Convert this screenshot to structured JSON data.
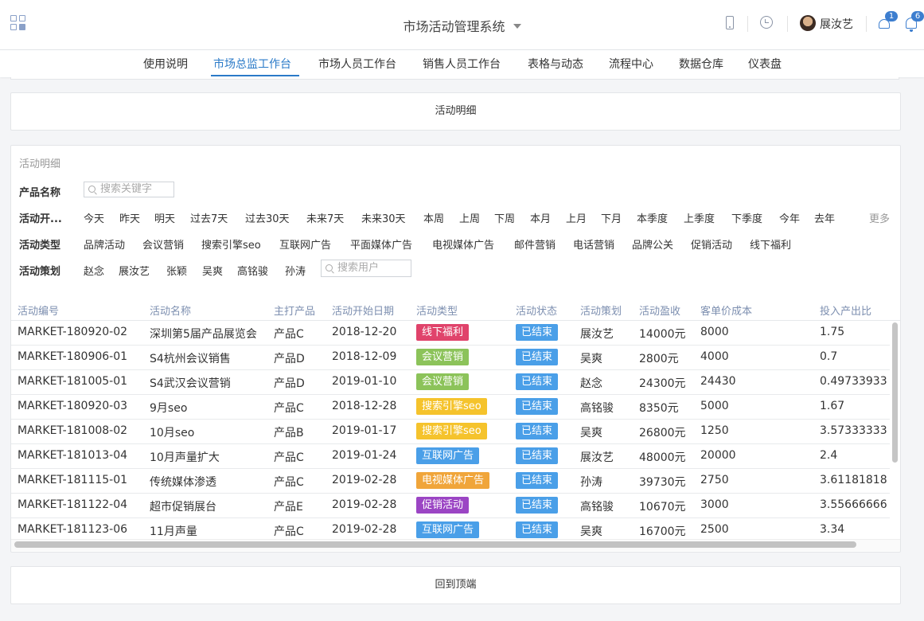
{
  "header": {
    "app_title": "市场活动管理系统",
    "username": "展汝艺",
    "share_badge": "1",
    "bell_badge": "6"
  },
  "nav": {
    "items": [
      "使用说明",
      "市场总监工作台",
      "市场人员工作台",
      "销售人员工作台",
      "表格与动态",
      "流程中心",
      "数据仓库",
      "仪表盘"
    ],
    "active": "市场总监工作台"
  },
  "top_button": "活动明细",
  "bottom_button": "回到顶端",
  "panel": {
    "title": "活动明细",
    "filters": {
      "product": {
        "label": "产品名称",
        "placeholder": "搜索关键字"
      },
      "date": {
        "label": "活动开...",
        "options": [
          "今天",
          "昨天",
          "明天",
          "过去7天",
          "过去30天",
          "未来7天",
          "未来30天",
          "本周",
          "上周",
          "下周",
          "本月",
          "上月",
          "下月",
          "本季度",
          "上季度",
          "下季度",
          "今年",
          "去年"
        ],
        "more": "更多"
      },
      "type": {
        "label": "活动类型",
        "options": [
          "品牌活动",
          "会议营销",
          "搜索引擎seo",
          "互联网广告",
          "平面媒体广告",
          "电视媒体广告",
          "邮件营销",
          "电话营销",
          "品牌公关",
          "促销活动",
          "线下福利"
        ]
      },
      "planner": {
        "label": "活动策划",
        "options": [
          "赵念",
          "展汝艺",
          "张颖",
          "吴爽",
          "高铭骏",
          "孙涛"
        ],
        "placeholder": "搜索用户"
      }
    },
    "columns": [
      "活动编号",
      "活动名称",
      "主打产品",
      "活动开始日期",
      "活动类型",
      "活动状态",
      "活动策划",
      "活动盈收",
      "客单价成本",
      "投入产出比"
    ],
    "rows": [
      {
        "id": "MARKET-180920-02",
        "name": "深圳第5届产品展览会",
        "product": "产品C",
        "date": "2018-12-20",
        "type": "线下福利",
        "type_color": "#e0436b",
        "status": "已结束",
        "planner": "展汝艺",
        "revenue": "14000元",
        "cost": "8000",
        "roi": "1.75"
      },
      {
        "id": "MARKET-180906-01",
        "name": "S4杭州会议销售",
        "product": "产品D",
        "date": "2018-12-09",
        "type": "会议营销",
        "type_color": "#8cc35a",
        "status": "已结束",
        "planner": "吴爽",
        "revenue": "2800元",
        "cost": "4000",
        "roi": "0.7"
      },
      {
        "id": "MARKET-181005-01",
        "name": "S4武汉会议营销",
        "product": "产品D",
        "date": "2019-01-10",
        "type": "会议营销",
        "type_color": "#8cc35a",
        "status": "已结束",
        "planner": "赵念",
        "revenue": "24300元",
        "cost": "24430",
        "roi": "0.49733933"
      },
      {
        "id": "MARKET-180920-03",
        "name": "9月seo",
        "product": "产品C",
        "date": "2018-12-28",
        "type": "搜索引擎seo",
        "type_color": "#f5c32c",
        "status": "已结束",
        "planner": "高铭骏",
        "revenue": "8350元",
        "cost": "5000",
        "roi": "1.67"
      },
      {
        "id": "MARKET-181008-02",
        "name": "10月seo",
        "product": "产品B",
        "date": "2019-01-17",
        "type": "搜索引擎seo",
        "type_color": "#f5c32c",
        "status": "已结束",
        "planner": "吴爽",
        "revenue": "26800元",
        "cost": "1250",
        "roi": "3.57333333"
      },
      {
        "id": "MARKET-181013-04",
        "name": "10月声量扩大",
        "product": "产品C",
        "date": "2019-01-24",
        "type": "互联网广告",
        "type_color": "#4a9fe8",
        "status": "已结束",
        "planner": "展汝艺",
        "revenue": "48000元",
        "cost": "20000",
        "roi": "2.4"
      },
      {
        "id": "MARKET-181115-01",
        "name": "传统媒体渗透",
        "product": "产品C",
        "date": "2019-02-28",
        "type": "电视媒体广告",
        "type_color": "#f0a53a",
        "status": "已结束",
        "planner": "孙涛",
        "revenue": "39730元",
        "cost": "2750",
        "roi": "3.61181818"
      },
      {
        "id": "MARKET-181122-04",
        "name": "超市促销展台",
        "product": "产品E",
        "date": "2019-02-28",
        "type": "促销活动",
        "type_color": "#9b45c4",
        "status": "已结束",
        "planner": "高铭骏",
        "revenue": "10670元",
        "cost": "3000",
        "roi": "3.55666666"
      },
      {
        "id": "MARKET-181123-06",
        "name": "11月声量",
        "product": "产品C",
        "date": "2019-02-28",
        "type": "互联网广告",
        "type_color": "#4a9fe8",
        "status": "已结束",
        "planner": "吴爽",
        "revenue": "16700元",
        "cost": "2500",
        "roi": "3.34"
      }
    ],
    "status_color": "#4a9fe8"
  }
}
